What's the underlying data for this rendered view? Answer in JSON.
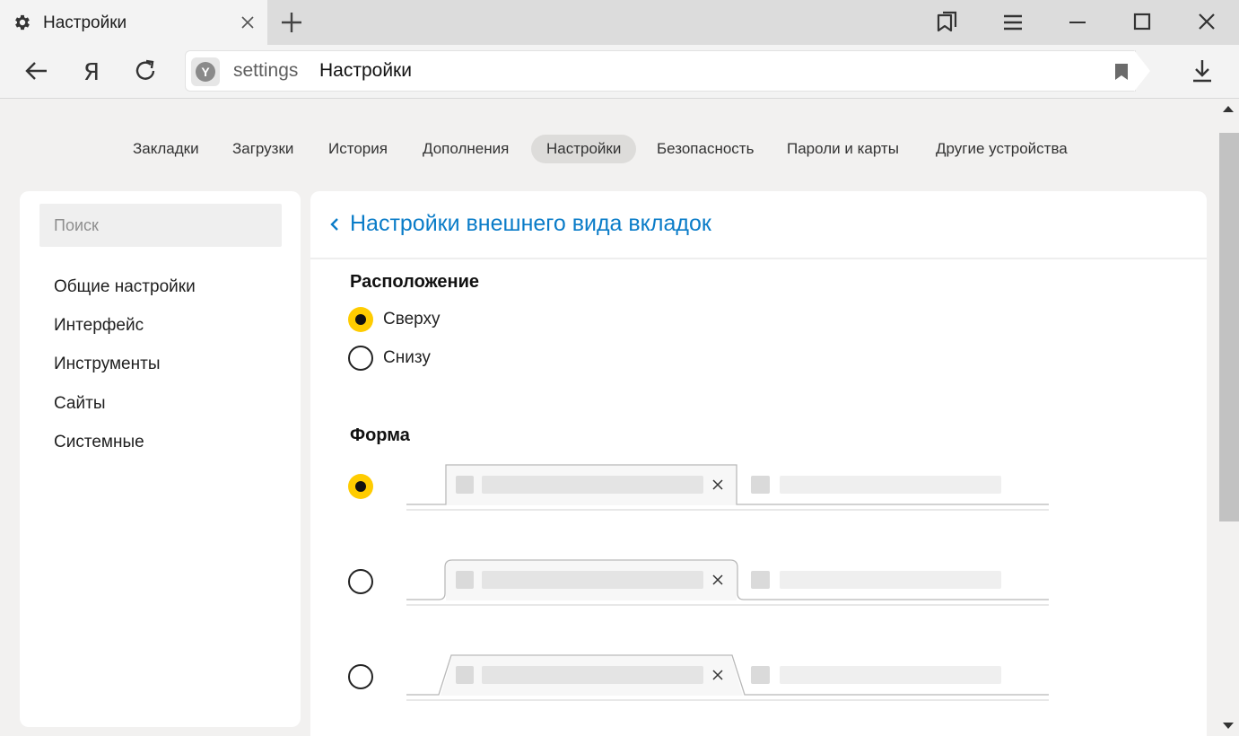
{
  "browser": {
    "tab_title": "Настройки",
    "tab_icon": "gear-icon",
    "address": {
      "host": "settings",
      "page_title": "Настройки"
    }
  },
  "nav": {
    "tabs": [
      {
        "label": "Закладки",
        "active": false
      },
      {
        "label": "Загрузки",
        "active": false
      },
      {
        "label": "История",
        "active": false
      },
      {
        "label": "Дополнения",
        "active": false
      },
      {
        "label": "Настройки",
        "active": true
      },
      {
        "label": "Безопасность",
        "active": false
      },
      {
        "label": "Пароли и карты",
        "active": false
      },
      {
        "label": "Другие устройства",
        "active": false
      }
    ]
  },
  "sidebar": {
    "search_placeholder": "Поиск",
    "items": [
      {
        "label": "Общие настройки"
      },
      {
        "label": "Интерфейс"
      },
      {
        "label": "Инструменты"
      },
      {
        "label": "Сайты"
      },
      {
        "label": "Системные"
      }
    ]
  },
  "main": {
    "title": "Настройки внешнего вида вкладок",
    "position": {
      "title": "Расположение",
      "options": [
        {
          "label": "Сверху",
          "checked": true
        },
        {
          "label": "Снизу",
          "checked": false
        }
      ]
    },
    "shape": {
      "title": "Форма",
      "options": [
        {
          "style": "square",
          "checked": true
        },
        {
          "style": "rounded",
          "checked": false
        },
        {
          "style": "trapezoid",
          "checked": false
        }
      ]
    }
  },
  "colors": {
    "accent_yellow": "#ffcc00",
    "link_blue": "#0a7cc8"
  }
}
